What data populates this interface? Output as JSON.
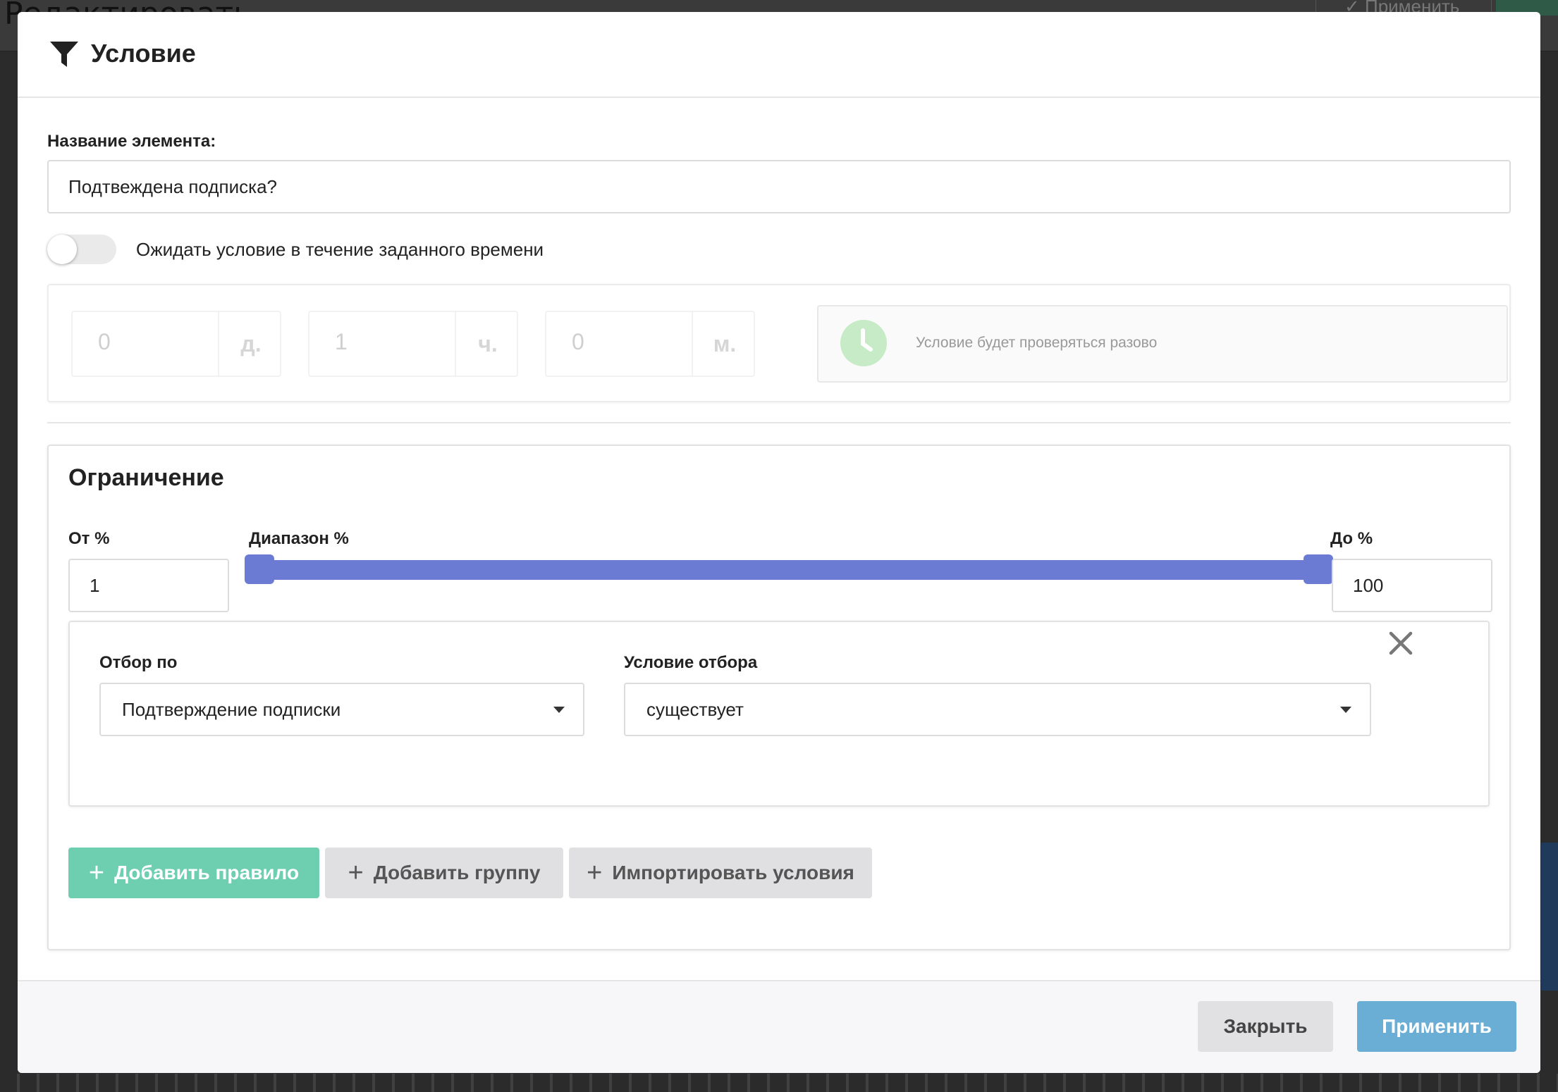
{
  "backdrop": {
    "page_title": "Редактировать",
    "apply_button": "✓ Применить"
  },
  "modal": {
    "title": "Условие",
    "title_icon": "filter-icon"
  },
  "element_name": {
    "label": "Название элемента:",
    "value": "Подтвеждена подписка?"
  },
  "wait_toggle": {
    "label": "Ожидать условие в течение заданного времени",
    "enabled": false
  },
  "timer": {
    "days": {
      "value": "0",
      "unit": "д."
    },
    "hours": {
      "value": "1",
      "unit": "ч."
    },
    "minutes": {
      "value": "0",
      "unit": "м."
    },
    "info_icon": "clock-icon",
    "info_text": "Условие будет проверяться разово"
  },
  "restriction": {
    "title": "Ограничение",
    "from_label": "От %",
    "from_value": "1",
    "range_label": "Диапазон %",
    "to_label": "До %",
    "to_value": "100",
    "range": [
      1,
      100
    ],
    "slider_color": "#6b7bd4"
  },
  "rule": {
    "filter_by_label": "Отбор по",
    "filter_by_value": "Подтверждение подписки",
    "condition_label": "Условие отбора",
    "condition_value": "существует",
    "remove_icon": "close-icon"
  },
  "actions": {
    "add_rule": "Добавить правило",
    "add_group": "Добавить группу",
    "import_conditions": "Импортировать условия",
    "add_rule_color": "#6dcfb0"
  },
  "footer": {
    "close": "Закрыть",
    "apply": "Применить",
    "apply_color": "#6aaed6"
  }
}
